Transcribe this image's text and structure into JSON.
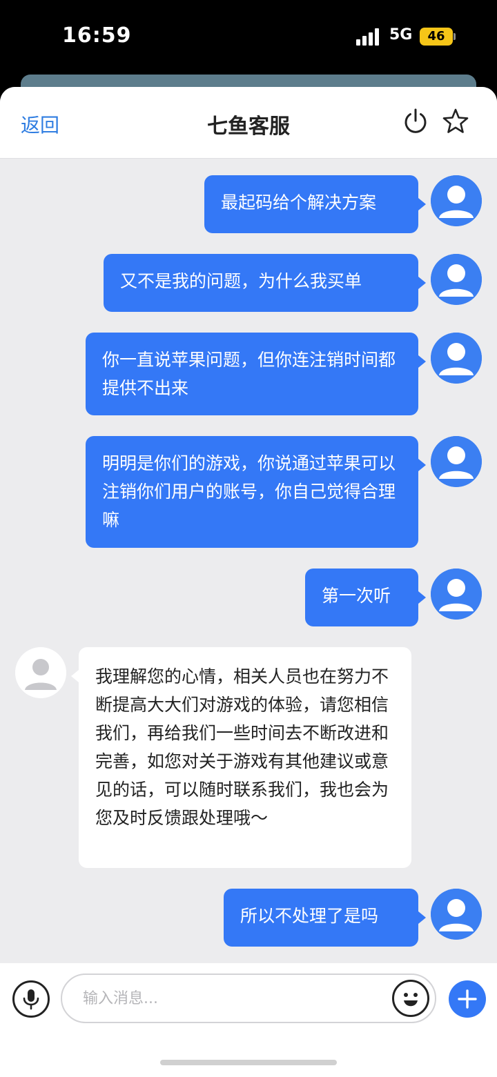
{
  "status_bar": {
    "time": "16:59",
    "network": "5G",
    "battery": "46"
  },
  "header": {
    "back_label": "返回",
    "title": "七鱼客服",
    "accent_color": "#2f7de1"
  },
  "messages": [
    {
      "sender": "user",
      "text": "最起码给个解决方案"
    },
    {
      "sender": "user",
      "text": "又不是我的问题，为什么我买单"
    },
    {
      "sender": "user",
      "text": "你一直说苹果问题，但你连注销时间都提供不出来"
    },
    {
      "sender": "user",
      "text": "明明是你们的游戏，你说通过苹果可以注销你们用户的账号，你自己觉得合理嘛"
    },
    {
      "sender": "user",
      "text": "第一次听"
    },
    {
      "sender": "agent",
      "text": "我理解您的心情，相关人员也在努力不断提高大大们对游戏的体验，请您相信我们，再给我们一些时间去不断改进和完善，如您对关于游戏有其他建议或意见的话，可以随时联系我们，我也会为您及时反馈跟处理哦～"
    },
    {
      "sender": "user",
      "text": "所以不处理了是吗"
    }
  ],
  "input": {
    "placeholder": "输入消息..."
  },
  "colors": {
    "user_bubble": "#3478f6",
    "agent_bubble": "#ffffff",
    "chat_background": "#ececee"
  },
  "icons": {
    "header_right": [
      "power-icon",
      "star-icon"
    ],
    "input_bar": [
      "microphone-icon",
      "emoji-icon",
      "plus-icon"
    ]
  }
}
